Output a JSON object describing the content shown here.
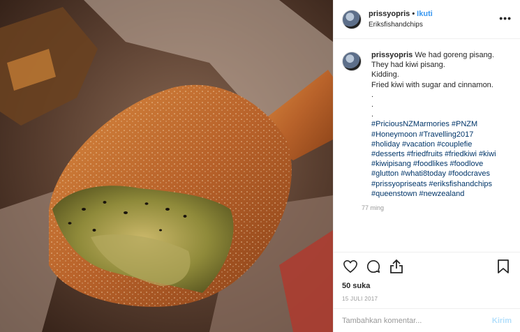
{
  "photo": {
    "alt_icon": "food-photo"
  },
  "header": {
    "username": "prissyopris",
    "separator": "•",
    "follow_label": "Ikuti",
    "location": "Eriksfishandchips",
    "more_icon": "more-dots-icon"
  },
  "post": {
    "username": "prissyopris",
    "caption": " We had goreng pisang.\nThey had kiwi pisang.\nKidding.\nFried kiwi with sugar and cinnamon.\n.\n.\n.",
    "hashtags": "#PriciousNZMarmories #PNZM\n#Honeymoon #Travelling2017\n#holiday #vacation #couplefie\n#desserts #friedfruits #friedkiwi #kiwi\n#kiwipisang #foodlikes #foodlove\n#glutton #whati8today #foodcraves\n#prissyopriseats #eriksfishandchips\n#queenstown #newzealand",
    "time": "77 ming"
  },
  "actions": {
    "like_icon": "heart-icon",
    "comment_icon": "comment-icon",
    "share_icon": "share-icon",
    "save_icon": "bookmark-icon",
    "likes": "50 suka",
    "date": "15 JULI 2017"
  },
  "comment_box": {
    "placeholder": "Tambahkan komentar...",
    "post_label": "Kirim"
  },
  "colors": {
    "link": "#3897f0",
    "hashtag": "#003569",
    "muted": "#999999"
  }
}
